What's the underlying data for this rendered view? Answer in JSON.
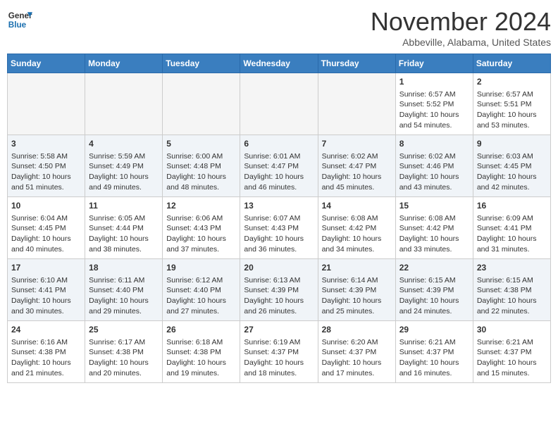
{
  "header": {
    "logo_line1": "General",
    "logo_line2": "Blue",
    "title": "November 2024",
    "location": "Abbeville, Alabama, United States"
  },
  "days_of_week": [
    "Sunday",
    "Monday",
    "Tuesday",
    "Wednesday",
    "Thursday",
    "Friday",
    "Saturday"
  ],
  "weeks": [
    [
      {
        "day": "",
        "info": ""
      },
      {
        "day": "",
        "info": ""
      },
      {
        "day": "",
        "info": ""
      },
      {
        "day": "",
        "info": ""
      },
      {
        "day": "",
        "info": ""
      },
      {
        "day": "1",
        "info": "Sunrise: 6:57 AM\nSunset: 5:52 PM\nDaylight: 10 hours\nand 54 minutes."
      },
      {
        "day": "2",
        "info": "Sunrise: 6:57 AM\nSunset: 5:51 PM\nDaylight: 10 hours\nand 53 minutes."
      }
    ],
    [
      {
        "day": "3",
        "info": "Sunrise: 5:58 AM\nSunset: 4:50 PM\nDaylight: 10 hours\nand 51 minutes."
      },
      {
        "day": "4",
        "info": "Sunrise: 5:59 AM\nSunset: 4:49 PM\nDaylight: 10 hours\nand 49 minutes."
      },
      {
        "day": "5",
        "info": "Sunrise: 6:00 AM\nSunset: 4:48 PM\nDaylight: 10 hours\nand 48 minutes."
      },
      {
        "day": "6",
        "info": "Sunrise: 6:01 AM\nSunset: 4:47 PM\nDaylight: 10 hours\nand 46 minutes."
      },
      {
        "day": "7",
        "info": "Sunrise: 6:02 AM\nSunset: 4:47 PM\nDaylight: 10 hours\nand 45 minutes."
      },
      {
        "day": "8",
        "info": "Sunrise: 6:02 AM\nSunset: 4:46 PM\nDaylight: 10 hours\nand 43 minutes."
      },
      {
        "day": "9",
        "info": "Sunrise: 6:03 AM\nSunset: 4:45 PM\nDaylight: 10 hours\nand 42 minutes."
      }
    ],
    [
      {
        "day": "10",
        "info": "Sunrise: 6:04 AM\nSunset: 4:45 PM\nDaylight: 10 hours\nand 40 minutes."
      },
      {
        "day": "11",
        "info": "Sunrise: 6:05 AM\nSunset: 4:44 PM\nDaylight: 10 hours\nand 38 minutes."
      },
      {
        "day": "12",
        "info": "Sunrise: 6:06 AM\nSunset: 4:43 PM\nDaylight: 10 hours\nand 37 minutes."
      },
      {
        "day": "13",
        "info": "Sunrise: 6:07 AM\nSunset: 4:43 PM\nDaylight: 10 hours\nand 36 minutes."
      },
      {
        "day": "14",
        "info": "Sunrise: 6:08 AM\nSunset: 4:42 PM\nDaylight: 10 hours\nand 34 minutes."
      },
      {
        "day": "15",
        "info": "Sunrise: 6:08 AM\nSunset: 4:42 PM\nDaylight: 10 hours\nand 33 minutes."
      },
      {
        "day": "16",
        "info": "Sunrise: 6:09 AM\nSunset: 4:41 PM\nDaylight: 10 hours\nand 31 minutes."
      }
    ],
    [
      {
        "day": "17",
        "info": "Sunrise: 6:10 AM\nSunset: 4:41 PM\nDaylight: 10 hours\nand 30 minutes."
      },
      {
        "day": "18",
        "info": "Sunrise: 6:11 AM\nSunset: 4:40 PM\nDaylight: 10 hours\nand 29 minutes."
      },
      {
        "day": "19",
        "info": "Sunrise: 6:12 AM\nSunset: 4:40 PM\nDaylight: 10 hours\nand 27 minutes."
      },
      {
        "day": "20",
        "info": "Sunrise: 6:13 AM\nSunset: 4:39 PM\nDaylight: 10 hours\nand 26 minutes."
      },
      {
        "day": "21",
        "info": "Sunrise: 6:14 AM\nSunset: 4:39 PM\nDaylight: 10 hours\nand 25 minutes."
      },
      {
        "day": "22",
        "info": "Sunrise: 6:15 AM\nSunset: 4:39 PM\nDaylight: 10 hours\nand 24 minutes."
      },
      {
        "day": "23",
        "info": "Sunrise: 6:15 AM\nSunset: 4:38 PM\nDaylight: 10 hours\nand 22 minutes."
      }
    ],
    [
      {
        "day": "24",
        "info": "Sunrise: 6:16 AM\nSunset: 4:38 PM\nDaylight: 10 hours\nand 21 minutes."
      },
      {
        "day": "25",
        "info": "Sunrise: 6:17 AM\nSunset: 4:38 PM\nDaylight: 10 hours\nand 20 minutes."
      },
      {
        "day": "26",
        "info": "Sunrise: 6:18 AM\nSunset: 4:38 PM\nDaylight: 10 hours\nand 19 minutes."
      },
      {
        "day": "27",
        "info": "Sunrise: 6:19 AM\nSunset: 4:37 PM\nDaylight: 10 hours\nand 18 minutes."
      },
      {
        "day": "28",
        "info": "Sunrise: 6:20 AM\nSunset: 4:37 PM\nDaylight: 10 hours\nand 17 minutes."
      },
      {
        "day": "29",
        "info": "Sunrise: 6:21 AM\nSunset: 4:37 PM\nDaylight: 10 hours\nand 16 minutes."
      },
      {
        "day": "30",
        "info": "Sunrise: 6:21 AM\nSunset: 4:37 PM\nDaylight: 10 hours\nand 15 minutes."
      }
    ]
  ]
}
